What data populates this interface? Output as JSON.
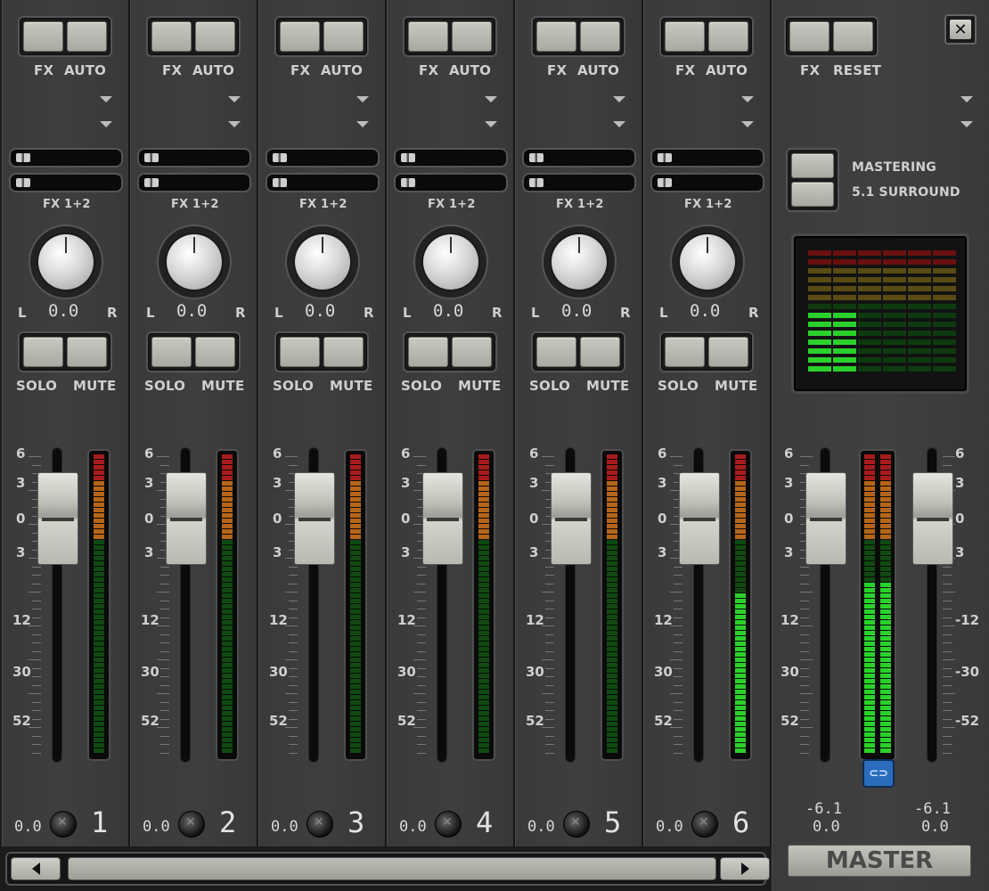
{
  "channels": [
    {
      "number": "1",
      "fx_label": "FX",
      "auto_label": "AUTO",
      "send_label": "FX 1+2",
      "pan_left": "L",
      "pan_right": "R",
      "pan_value": "0.0",
      "solo_label": "SOLO",
      "mute_label": "MUTE",
      "gain_value": "0.0",
      "meter_level": 0.0
    },
    {
      "number": "2",
      "fx_label": "FX",
      "auto_label": "AUTO",
      "send_label": "FX 1+2",
      "pan_left": "L",
      "pan_right": "R",
      "pan_value": "0.0",
      "solo_label": "SOLO",
      "mute_label": "MUTE",
      "gain_value": "0.0",
      "meter_level": 0.0
    },
    {
      "number": "3",
      "fx_label": "FX",
      "auto_label": "AUTO",
      "send_label": "FX 1+2",
      "pan_left": "L",
      "pan_right": "R",
      "pan_value": "0.0",
      "solo_label": "SOLO",
      "mute_label": "MUTE",
      "gain_value": "0.0",
      "meter_level": 0.0
    },
    {
      "number": "4",
      "fx_label": "FX",
      "auto_label": "AUTO",
      "send_label": "FX 1+2",
      "pan_left": "L",
      "pan_right": "R",
      "pan_value": "0.0",
      "solo_label": "SOLO",
      "mute_label": "MUTE",
      "gain_value": "0.0",
      "meter_level": 0.0
    },
    {
      "number": "5",
      "fx_label": "FX",
      "auto_label": "AUTO",
      "send_label": "FX 1+2",
      "pan_left": "L",
      "pan_right": "R",
      "pan_value": "0.0",
      "solo_label": "SOLO",
      "mute_label": "MUTE",
      "gain_value": "0.0",
      "meter_level": 0.0
    },
    {
      "number": "6",
      "fx_label": "FX",
      "auto_label": "AUTO",
      "send_label": "FX 1+2",
      "pan_left": "L",
      "pan_right": "R",
      "pan_value": "0.0",
      "solo_label": "SOLO",
      "mute_label": "MUTE",
      "gain_value": "0.0",
      "meter_level": 0.55
    }
  ],
  "scale_labels": [
    "6",
    "3",
    "0",
    "3",
    "12",
    "30",
    "52"
  ],
  "master": {
    "fx_label": "FX",
    "reset_label": "RESET",
    "mode_line1": "MASTERING",
    "mode_line2": "5.1 SURROUND",
    "left_peak": "-6.1",
    "left_value": "0.0",
    "right_peak": "-6.1",
    "right_value": "0.0",
    "title": "MASTER",
    "right_scale_labels": [
      "6",
      "3",
      "0",
      "3",
      "-12",
      "-30",
      "-52"
    ],
    "meter_left_level": 0.58,
    "meter_right_level": 0.58,
    "surround_levels": [
      0.55,
      0.55,
      0.0,
      0.0,
      0.0,
      0.0
    ],
    "link_label": "⊂⊃"
  },
  "close_label": "✕",
  "colors": {
    "meter_green": "#2bd12b",
    "meter_dim_green": "#0f4a10",
    "meter_orange": "#b5651a",
    "meter_red": "#a81b1b",
    "link_blue": "#2a6dbc"
  }
}
